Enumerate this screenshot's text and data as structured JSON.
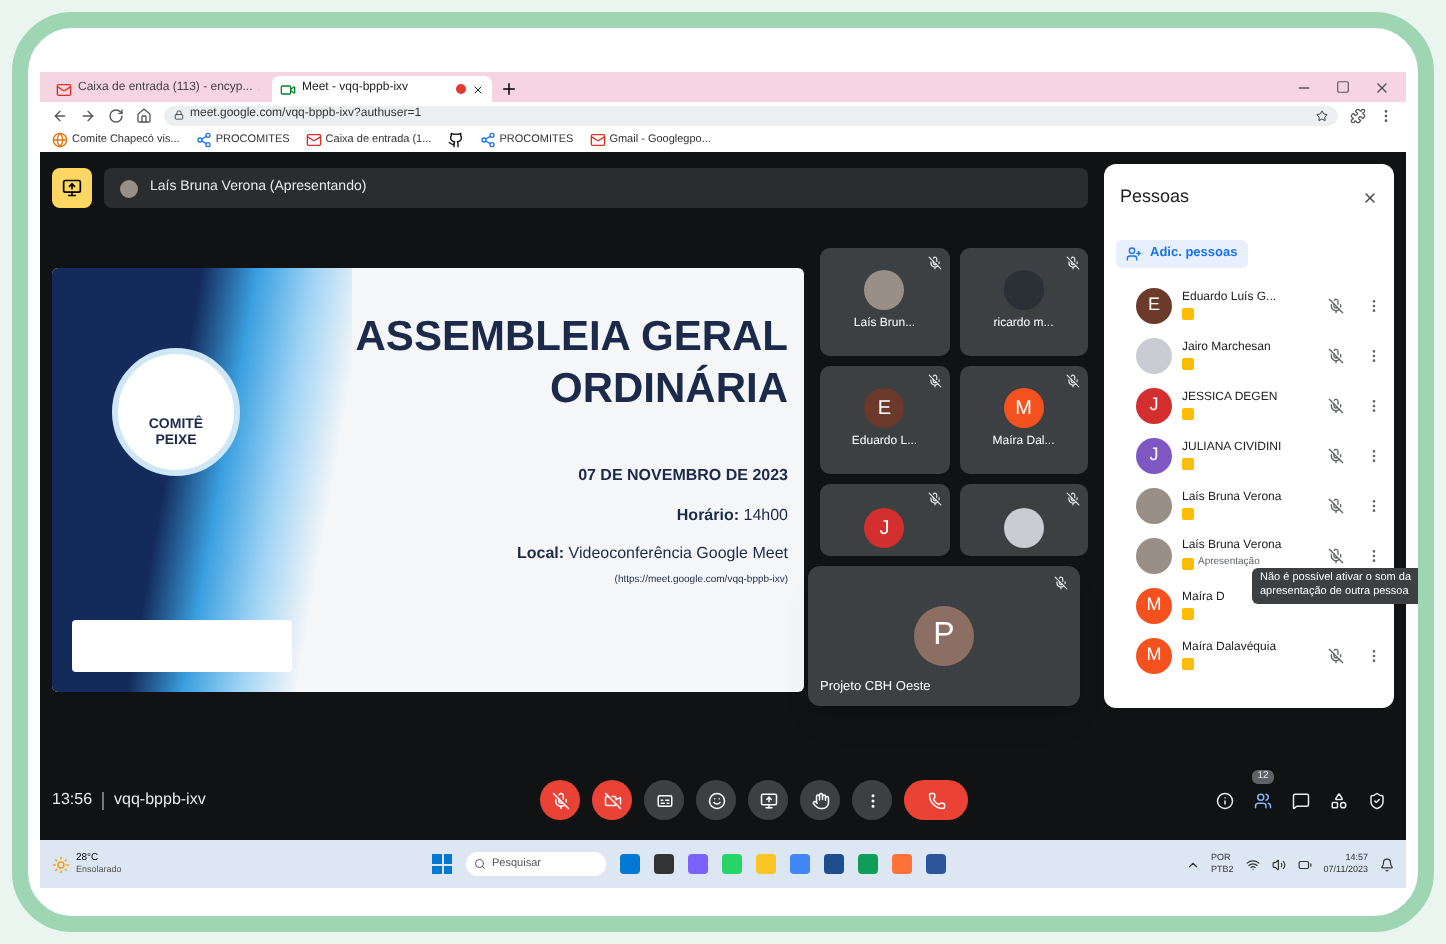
{
  "browser": {
    "tabs": [
      {
        "title": "Caixa de entrada (113) - encyp...",
        "kind": "gmail",
        "selected": false
      },
      {
        "title": "Meet - vqq-bppb-ixv",
        "kind": "meet",
        "selected": true
      }
    ],
    "url": "meet.google.com/vqq-bppb-ixv?authuser=1",
    "bookmarks": [
      {
        "label": "Comite Chapecó vis...",
        "kind": "site"
      },
      {
        "label": "PROCOMITES",
        "kind": "link"
      },
      {
        "label": "Caixa de entrada (1...",
        "kind": "gmail"
      },
      {
        "kind": "github"
      },
      {
        "label": "PROCOMITES",
        "kind": "link"
      },
      {
        "label": "Gmail - Googlegpo...",
        "kind": "gmail"
      }
    ]
  },
  "meet": {
    "presenter": "Laís Bruna Verona (Apresentando)",
    "slide": {
      "logo_lines": [
        "COMITÊ",
        "PEIXE"
      ],
      "title_lines": [
        "ASSEMBLEIA GERAL",
        "ORDINÁRIA"
      ],
      "date": "07 DE NOVEMBRO DE 2023",
      "time_line": "**Horário:** 14h00",
      "place_line": "**Local:** Videoconferência Google Meet",
      "link": "(https://meet.google.com/vqq-bppb-ixv)"
    },
    "tiles": [
      {
        "name": "Laís Brun...",
        "kind": "photo",
        "color": "#9a8f86"
      },
      {
        "name": "ricardo m...",
        "kind": "photo",
        "color": "#2b2f36"
      },
      {
        "name": "Eduardo L...",
        "kind": "letter",
        "letter": "E",
        "color": "#6b3a2a"
      },
      {
        "name": "Maíra Dal...",
        "kind": "letter",
        "letter": "M",
        "color": "#f4511e"
      },
      {
        "kind": "letter",
        "letter": "J",
        "color": "#d32f2f"
      },
      {
        "kind": "photo",
        "color": "#c9ccd2"
      }
    ],
    "floating_tile": {
      "name": "Projeto CBH Oeste",
      "letter": "P",
      "color": "#8d6e63"
    },
    "people": {
      "title": "Pessoas",
      "add": "Adic. pessoas",
      "members": [
        {
          "name": "Eduardo Luís G...",
          "kind": "letter",
          "letter": "E",
          "color": "#6b3a2a"
        },
        {
          "name": "Jairo Marchesan",
          "kind": "photo",
          "color": "#c9ccd2"
        },
        {
          "name": "JESSICA DEGEN",
          "kind": "letter",
          "letter": "J",
          "color": "#d32f2f"
        },
        {
          "name": "JULIANA CIVIDINI",
          "kind": "letter",
          "letter": "J",
          "color": "#7e57c2"
        },
        {
          "name": "Laís Bruna Verona",
          "kind": "photo",
          "color": "#9a8f86"
        },
        {
          "name": "Laís Bruna Verona",
          "kind": "photo",
          "color": "#9a8f86",
          "note": "Apresentação"
        },
        {
          "name": "Maíra D",
          "kind": "letter",
          "letter": "M",
          "color": "#f4511e",
          "tooltip": "Não é possível ativar o som da apresentação de outra pessoa"
        },
        {
          "name": "Maíra Dalavéquia",
          "kind": "letter",
          "letter": "M",
          "color": "#f4511e"
        }
      ]
    },
    "clock": "13:56",
    "code": "vqq-bppb-ixv",
    "controls": [
      {
        "kind": "mic",
        "on": false
      },
      {
        "kind": "camera",
        "on": false
      },
      {
        "kind": "captions",
        "on": false
      },
      {
        "kind": "emoji",
        "on": false
      },
      {
        "kind": "present",
        "on": false
      },
      {
        "kind": "hand",
        "on": false
      },
      {
        "kind": "more",
        "on": false
      },
      {
        "kind": "end"
      }
    ],
    "people_count": "12"
  },
  "taskbar": {
    "temperature": "28°C",
    "weather": "Ensolarado",
    "search": "Pesquisar",
    "apps": [
      {
        "color": "#0078d4"
      },
      {
        "color": "#333333"
      },
      {
        "color": "#7b61ff"
      },
      {
        "color": "#25d366"
      },
      {
        "color": "#f9c623"
      },
      {
        "color": "#4285f4"
      },
      {
        "color": "#1e4e8c"
      },
      {
        "color": "#0f9d58"
      },
      {
        "color": "#ff7139"
      },
      {
        "color": "#2b579a"
      }
    ],
    "language": [
      "POR",
      "PTB2"
    ],
    "time": "14:57",
    "date": "07/11/2023"
  }
}
